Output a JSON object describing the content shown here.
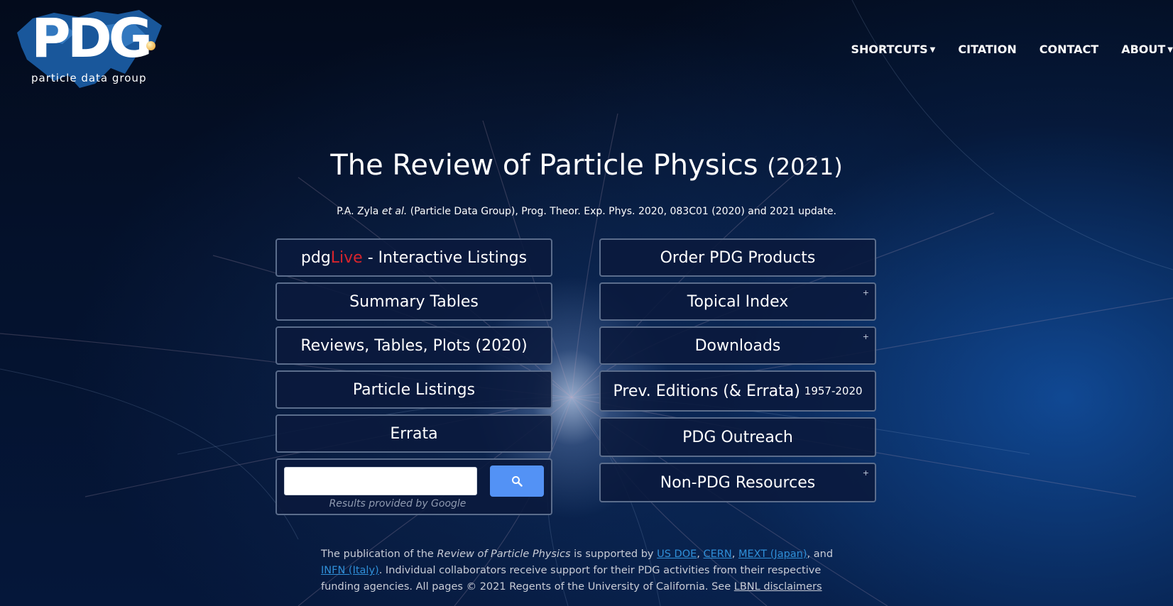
{
  "logo": {
    "wordmark": "PDG",
    "subtitle": "particle data group"
  },
  "nav": {
    "items": [
      {
        "label": "SHORTCUTS",
        "has_dropdown": true
      },
      {
        "label": "CITATION",
        "has_dropdown": false
      },
      {
        "label": "CONTACT",
        "has_dropdown": false
      },
      {
        "label": "ABOUT",
        "has_dropdown": true
      }
    ]
  },
  "title": {
    "main": "The Review of Particle Physics",
    "year": "(2021)"
  },
  "citation": {
    "authors": "P.A. Zyla",
    "et_al": "et al.",
    "rest": "(Particle Data Group), Prog. Theor. Exp. Phys. 2020, 083C01 (2020) and 2021 update."
  },
  "left_buttons": {
    "pdglive_prefix": "pdg",
    "pdglive_accent": "Live",
    "pdglive_suffix": " - Interactive Listings",
    "summary_tables": "Summary Tables",
    "reviews": "Reviews, Tables, Plots (2020)",
    "particle_listings": "Particle Listings",
    "errata": "Errata"
  },
  "right_buttons": {
    "order": "Order PDG Products",
    "topical_index": "Topical Index",
    "downloads": "Downloads",
    "prev_editions": "Prev. Editions (& Errata)",
    "prev_editions_years": "1957-2020",
    "outreach": "PDG Outreach",
    "non_pdg": "Non-PDG Resources",
    "expand_marker": "+"
  },
  "search": {
    "value": "",
    "note": "Results provided by Google",
    "button_icon": "search-icon"
  },
  "footer": {
    "p1": "The publication of the ",
    "rpp": "Review of Particle Physics",
    "p2": " is supported by ",
    "link_doe": "US DOE",
    "sep1": ", ",
    "link_cern": "CERN",
    "sep2": ", ",
    "link_mext": "MEXT (Japan)",
    "p3": ", and",
    "link_infn": "INFN (Italy)",
    "p4": ". Individual collaborators receive support for their PDG activities from their respective funding agencies. All pages © 2021 Regents of the University of California. See ",
    "link_lbnl": "LBNL disclaimers"
  },
  "colors": {
    "accent_live": "#d8242c",
    "search_button": "#5392f5",
    "link": "#2f8fd8",
    "button_bg": "#0a193c",
    "button_border": "#5b6d8c"
  }
}
